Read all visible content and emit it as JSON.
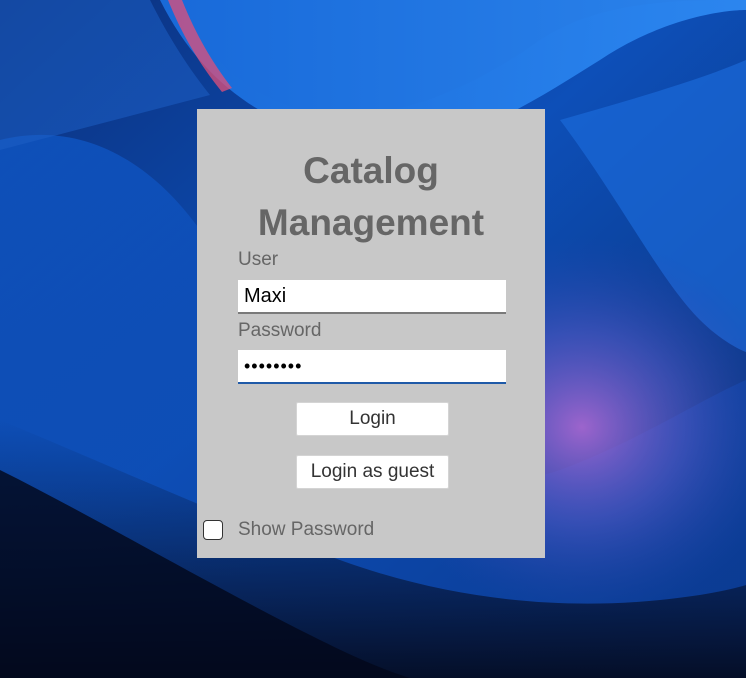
{
  "window": {
    "title": "Catalog\nManagement"
  },
  "form": {
    "user_label": "User",
    "user_value": "Maxi",
    "password_label": "Password",
    "password_masked": "••••••••",
    "login_label": "Login",
    "guest_label": "Login as guest",
    "show_password_label": "Show Password",
    "show_password_checked": false
  },
  "colors": {
    "panel_background": "#c8c8c8",
    "title_text": "#666666",
    "password_focus_underline": "#1f5aa8"
  }
}
